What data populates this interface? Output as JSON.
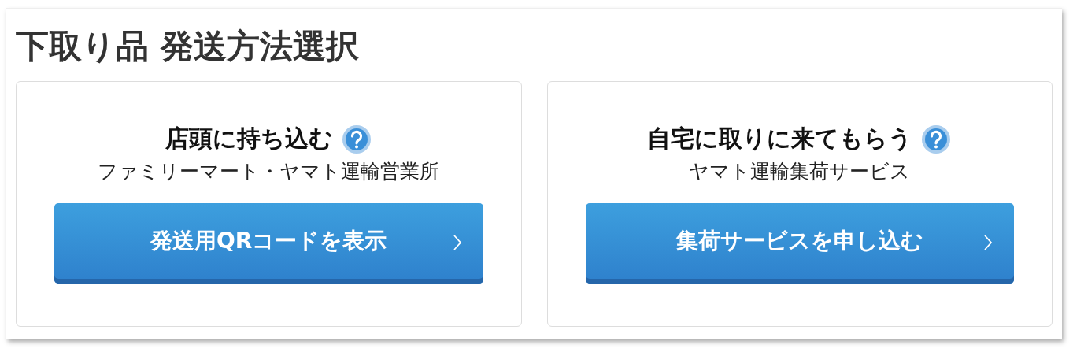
{
  "title": "下取り品 発送方法選択",
  "options": [
    {
      "heading": "店頭に持ち込む",
      "subtitle": "ファミリーマート・ヤマト運輸営業所",
      "button": "発送用QRコードを表示"
    },
    {
      "heading": "自宅に取りに来てもらう",
      "subtitle": "ヤマト運輸集荷サービス",
      "button": "集荷サービスを申し込む"
    }
  ]
}
